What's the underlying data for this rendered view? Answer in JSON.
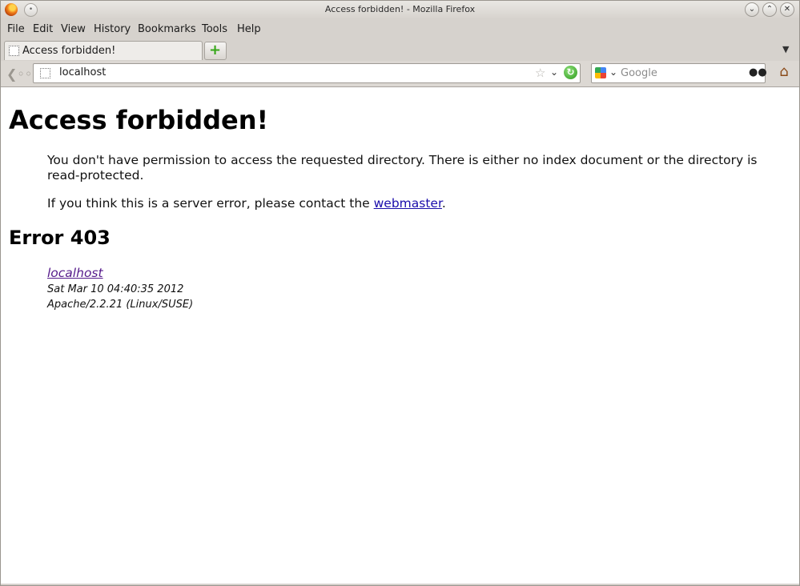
{
  "window": {
    "title": "Access forbidden! - Mozilla Firefox"
  },
  "menu": [
    "File",
    "Edit",
    "View",
    "History",
    "Bookmarks",
    "Tools",
    "Help"
  ],
  "tab": {
    "label": "Access forbidden!"
  },
  "nav": {
    "url": "localhost",
    "search_placeholder": "Google"
  },
  "page": {
    "heading": "Access forbidden!",
    "paragraph1": "You don't have permission to access the requested directory. There is either no index document or the directory is read-protected.",
    "paragraph2_prefix": "If you think this is a server error, please contact the ",
    "paragraph2_link": "webmaster",
    "paragraph2_suffix": ".",
    "error_heading": "Error 403",
    "host_link": "localhost",
    "date": "Sat Mar 10 04:40:35 2012",
    "server": "Apache/2.2.21 (Linux/SUSE)"
  }
}
